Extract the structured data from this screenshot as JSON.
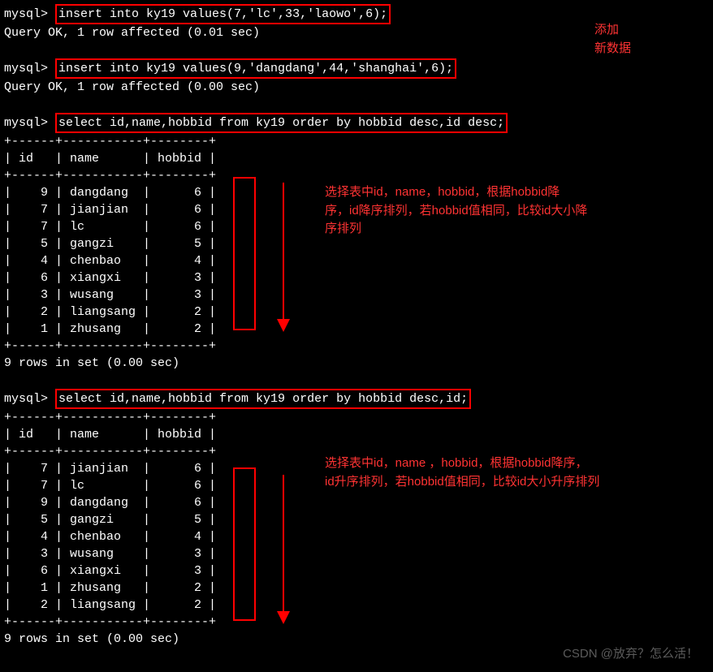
{
  "prompt": "mysql> ",
  "cmd1": "insert into ky19 values(7,'lc',33,'laowo',6);",
  "result1": "Query OK, 1 row affected (0.01 sec)",
  "cmd2": "insert into ky19 values(9,'dangdang',44,'shanghai',6);",
  "result2": "Query OK, 1 row affected (0.00 sec)",
  "cmd3": "select id,name,hobbid from ky19 order by hobbid desc,id desc;",
  "cmd4": "select id,name,hobbid from ky19 order by hobbid desc,id;",
  "table_sep": "+------+-----------+--------+",
  "table_header": "| id   | name      | hobbid |",
  "table1_rows": [
    "|    9 | dangdang  |      6 |",
    "|    7 | jianjian  |      6 |",
    "|    7 | lc        |      6 |",
    "|    5 | gangzi    |      5 |",
    "|    4 | chenbao   |      4 |",
    "|    6 | xiangxi   |      3 |",
    "|    3 | wusang    |      3 |",
    "|    2 | liangsang |      2 |",
    "|    1 | zhusang   |      2 |"
  ],
  "table2_rows": [
    "|    7 | jianjian  |      6 |",
    "|    7 | lc        |      6 |",
    "|    9 | dangdang  |      6 |",
    "|    5 | gangzi    |      5 |",
    "|    4 | chenbao   |      4 |",
    "|    3 | wusang    |      3 |",
    "|    6 | xiangxi   |      3 |",
    "|    1 | zhusang   |      2 |",
    "|    2 | liangsang |      2 |"
  ],
  "rows_result": "9 rows in set (0.00 sec)",
  "anno_top1": "添加",
  "anno_top2": "新数据",
  "anno_mid": "选择表中id，name，hobbid，根据hobbid降\n序，id降序排列，若hobbid值相同，比较id大小降\n序排列",
  "anno_bot": "选择表中id，name ，hobbid，根据hobbid降序，\nid升序排列，若hobbid值相同，比较id大小升序排列",
  "watermark": "CSDN @放弃？怎么活！"
}
